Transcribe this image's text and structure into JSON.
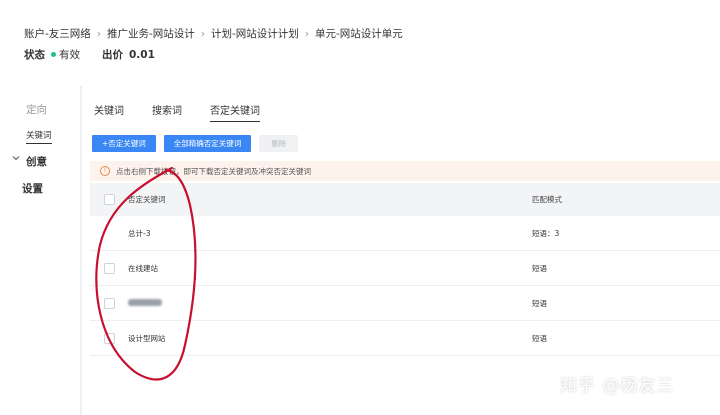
{
  "breadcrumb": [
    "账户-友三网络",
    "推广业务-网站设计",
    "计划-网站设计计划",
    "单元-网站设计单元"
  ],
  "status": {
    "label": "状态",
    "value": "有效",
    "dot_color": "#1ec47f",
    "bid_label": "出价",
    "bid_value": "0.01"
  },
  "sidebar": {
    "targeting": "定向",
    "keywords_sub": "关键词",
    "creative": "创意",
    "settings": "设置"
  },
  "tabs": [
    {
      "label": "关键词",
      "active": false
    },
    {
      "label": "搜索词",
      "active": false
    },
    {
      "label": "否定关键词",
      "active": true
    }
  ],
  "buttons": {
    "add_negative": "+否定关键词",
    "search_all": "全部精确否定关键词",
    "delete": "删除"
  },
  "notice": "点击右侧下载按钮，即可下载否定关键词及冲突否定关键词",
  "table": {
    "headers": {
      "keyword": "否定关键词",
      "match": "匹配模式"
    },
    "total_row": {
      "keyword": "总计-3",
      "match": "短语：3"
    },
    "rows": [
      {
        "keyword": "在线建站",
        "match": "短语"
      },
      {
        "keyword": "",
        "match": "短语"
      },
      {
        "keyword": "设计型网站",
        "match": "短语"
      }
    ]
  },
  "watermark": "知乎 @杨友三",
  "accent_color": "#3a86f5",
  "annotation_color": "#c8102e"
}
